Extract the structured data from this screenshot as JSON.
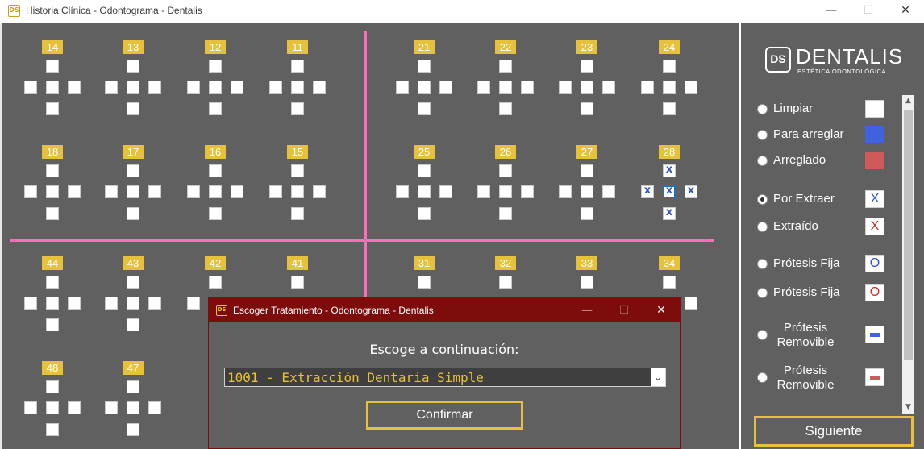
{
  "window": {
    "title": "Historia Clínica - Odontograma - Dentalis",
    "icon_name": "dentalis-app-icon"
  },
  "teeth": {
    "row1": [
      "14",
      "13",
      "12",
      "11",
      "21",
      "22",
      "23",
      "24"
    ],
    "row2": [
      "18",
      "17",
      "16",
      "15",
      "25",
      "26",
      "27",
      "28"
    ],
    "row3": [
      "44",
      "43",
      "42",
      "41",
      "31",
      "32",
      "33",
      "34"
    ],
    "row4": [
      "48",
      "47"
    ],
    "marked_tooth": "28",
    "mark_symbol": "x"
  },
  "sidebar": {
    "logo": {
      "mark": "DS",
      "name": "DENTALIS",
      "tagline": "ESTÉTICA ODONTOLÓGICA"
    },
    "options": [
      {
        "label": "Limpiar",
        "swatch_type": "fill",
        "color": "#ffffff",
        "selected": false
      },
      {
        "label": "Para arreglar",
        "swatch_type": "fill",
        "color": "#3f63e0",
        "selected": false
      },
      {
        "label": "Arreglado",
        "swatch_type": "fill",
        "color": "#d05a5a",
        "selected": false
      },
      {
        "label": "Por Extraer",
        "swatch_type": "glyph",
        "glyph": "X",
        "color": "#2f55c9",
        "selected": true
      },
      {
        "label": "Extraído",
        "swatch_type": "glyph",
        "glyph": "X",
        "color": "#c93030",
        "selected": false
      },
      {
        "label": "Prótesis Fija",
        "swatch_type": "glyph",
        "glyph": "O",
        "color": "#2f55c9",
        "selected": false
      },
      {
        "label": "Prótesis Fija",
        "swatch_type": "glyph",
        "glyph": "O",
        "color": "#c93030",
        "selected": false
      },
      {
        "label_line1": "Prótesis",
        "label_line2": "Removible",
        "swatch_type": "bar",
        "color": "#3f63e0",
        "selected": false
      },
      {
        "label_line1": "Prótesis",
        "label_line2": "Removible",
        "swatch_type": "bar",
        "color": "#d05a5a",
        "selected": false
      }
    ],
    "next_label": "Siguiente"
  },
  "dialog": {
    "title": "Escoger Tratamiento - Odontograma - Dentalis",
    "prompt": "Escoge a continuación:",
    "selected_treatment": "1001 - Extracción Dentaria Simple",
    "confirm_label": "Confirmar"
  },
  "colors": {
    "accent": "#e6c13c",
    "divider": "#ff6eb4",
    "dialog_title": "#7d0c0c",
    "panel": "#606060"
  }
}
